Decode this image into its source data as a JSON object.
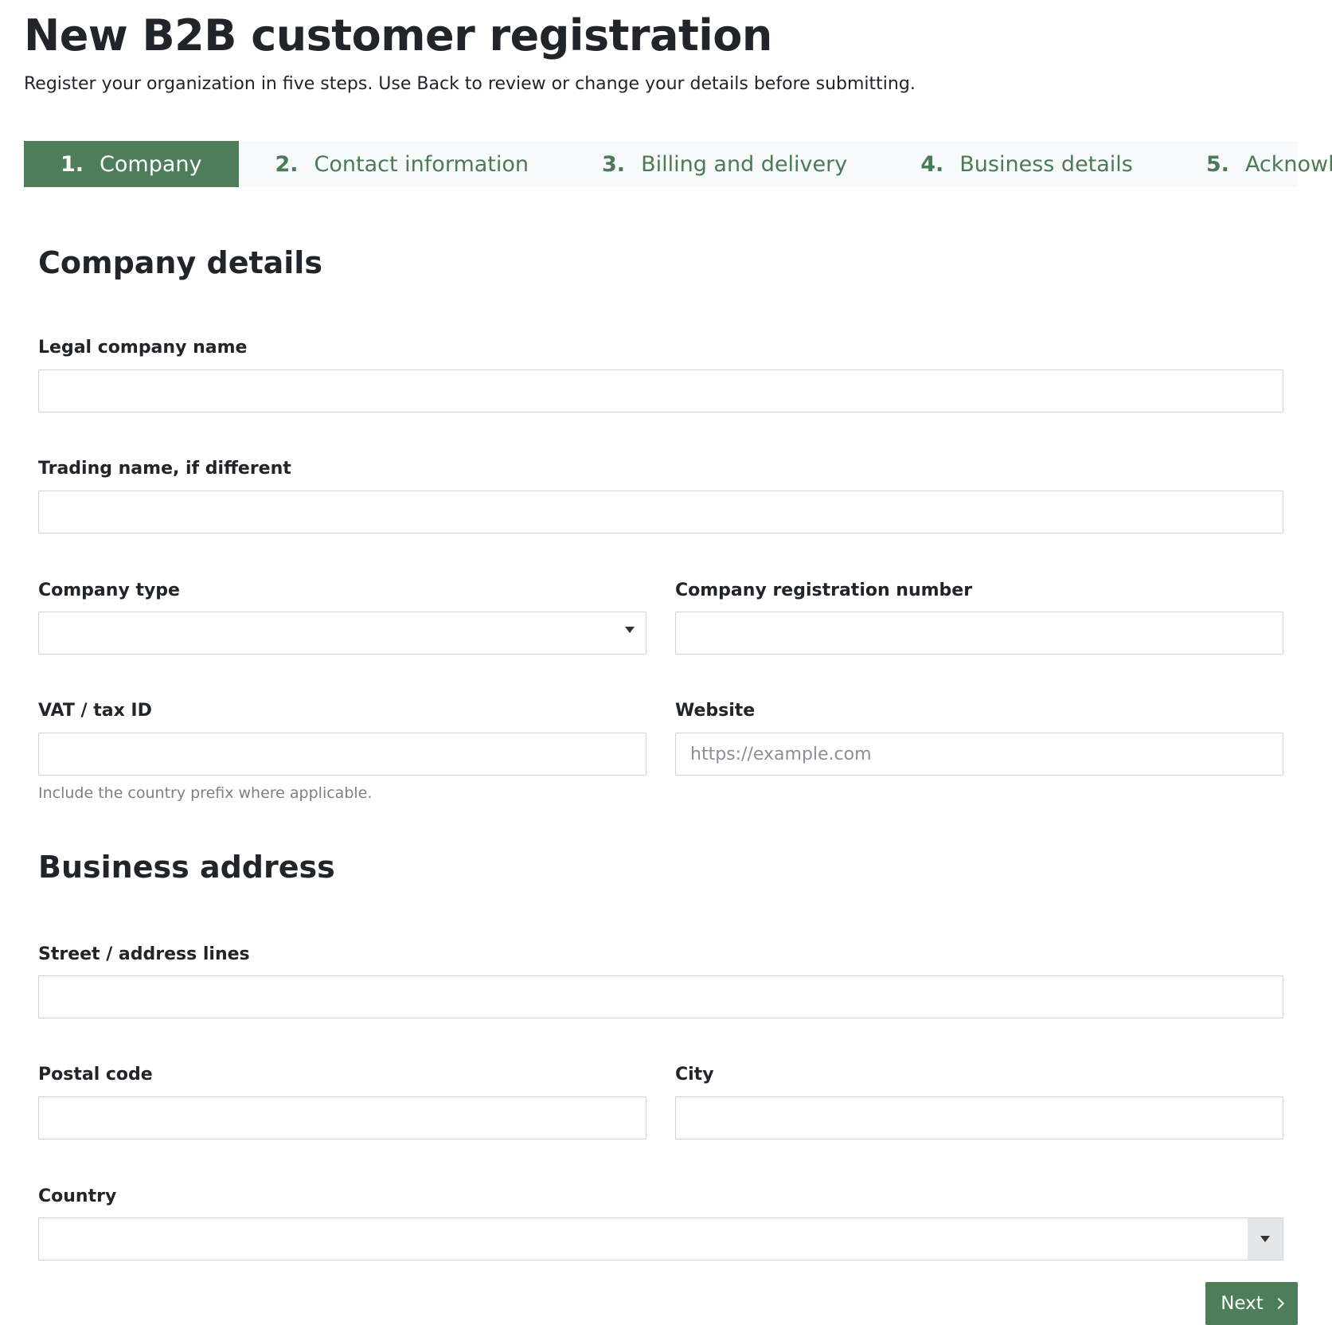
{
  "page": {
    "title": "New B2B customer registration",
    "intro": "Register your organization in five steps. Use Back to review or change your details before submitting."
  },
  "steps": [
    {
      "number": "1.",
      "label": "Company",
      "active": true
    },
    {
      "number": "2.",
      "label": "Contact information",
      "active": false
    },
    {
      "number": "3.",
      "label": "Billing and delivery",
      "active": false
    },
    {
      "number": "4.",
      "label": "Business details",
      "active": false
    },
    {
      "number": "5.",
      "label": "Acknowledge",
      "active": false
    }
  ],
  "company_details": {
    "heading": "Company details",
    "legal_name": {
      "label": "Legal company name",
      "value": "",
      "placeholder": ""
    },
    "trading_name": {
      "label": "Trading name, if different",
      "value": "",
      "placeholder": ""
    },
    "company_type": {
      "label": "Company type",
      "selected": ""
    },
    "registration_number": {
      "label": "Company registration number",
      "value": "",
      "placeholder": ""
    },
    "vat_id": {
      "label": "VAT / tax ID",
      "value": "",
      "placeholder": "",
      "help": "Include the country prefix where applicable."
    },
    "website": {
      "label": "Website",
      "value": "",
      "placeholder": "https://example.com"
    }
  },
  "business_address": {
    "heading": "Business address",
    "street": {
      "label": "Street / address lines",
      "value": "",
      "placeholder": ""
    },
    "postal_code": {
      "label": "Postal code",
      "value": "",
      "placeholder": ""
    },
    "city": {
      "label": "City",
      "value": "",
      "placeholder": ""
    },
    "country": {
      "label": "Country",
      "selected": ""
    }
  },
  "actions": {
    "next_label": "Next",
    "next_icon": "chevron-right-icon"
  },
  "colors": {
    "accent": "#4e7d5a",
    "step_text": "#4a7a56",
    "stepper_bg": "#f8f9fa",
    "border": "#ced4da",
    "help_text": "#7b8187"
  }
}
